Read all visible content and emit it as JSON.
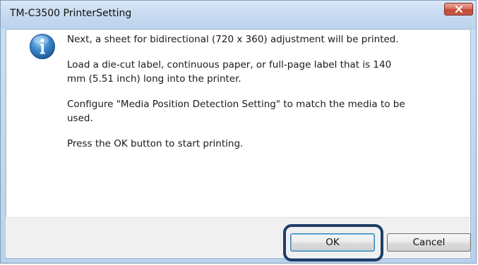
{
  "window": {
    "title": "TM-C3500 PrinterSetting"
  },
  "titlebar": {
    "close_icon": "close-icon"
  },
  "dialog": {
    "icon": "info-icon",
    "messages": [
      "Next, a sheet for bidirectional (720 x 360) adjustment will be printed.",
      "Load a die-cut label, continuous paper, or full-page label that is 140\nmm (5.51 inch) long into the printer.",
      "Configure \"Media Position Detection Setting\" to match the media to be\nused.",
      "Press the OK button to start printing."
    ]
  },
  "buttons": {
    "ok_label": "OK",
    "cancel_label": "Cancel"
  },
  "colors": {
    "highlight_border": "#1f3e66",
    "close_button": "#c24a35",
    "info_icon": "#2f6fb0"
  }
}
